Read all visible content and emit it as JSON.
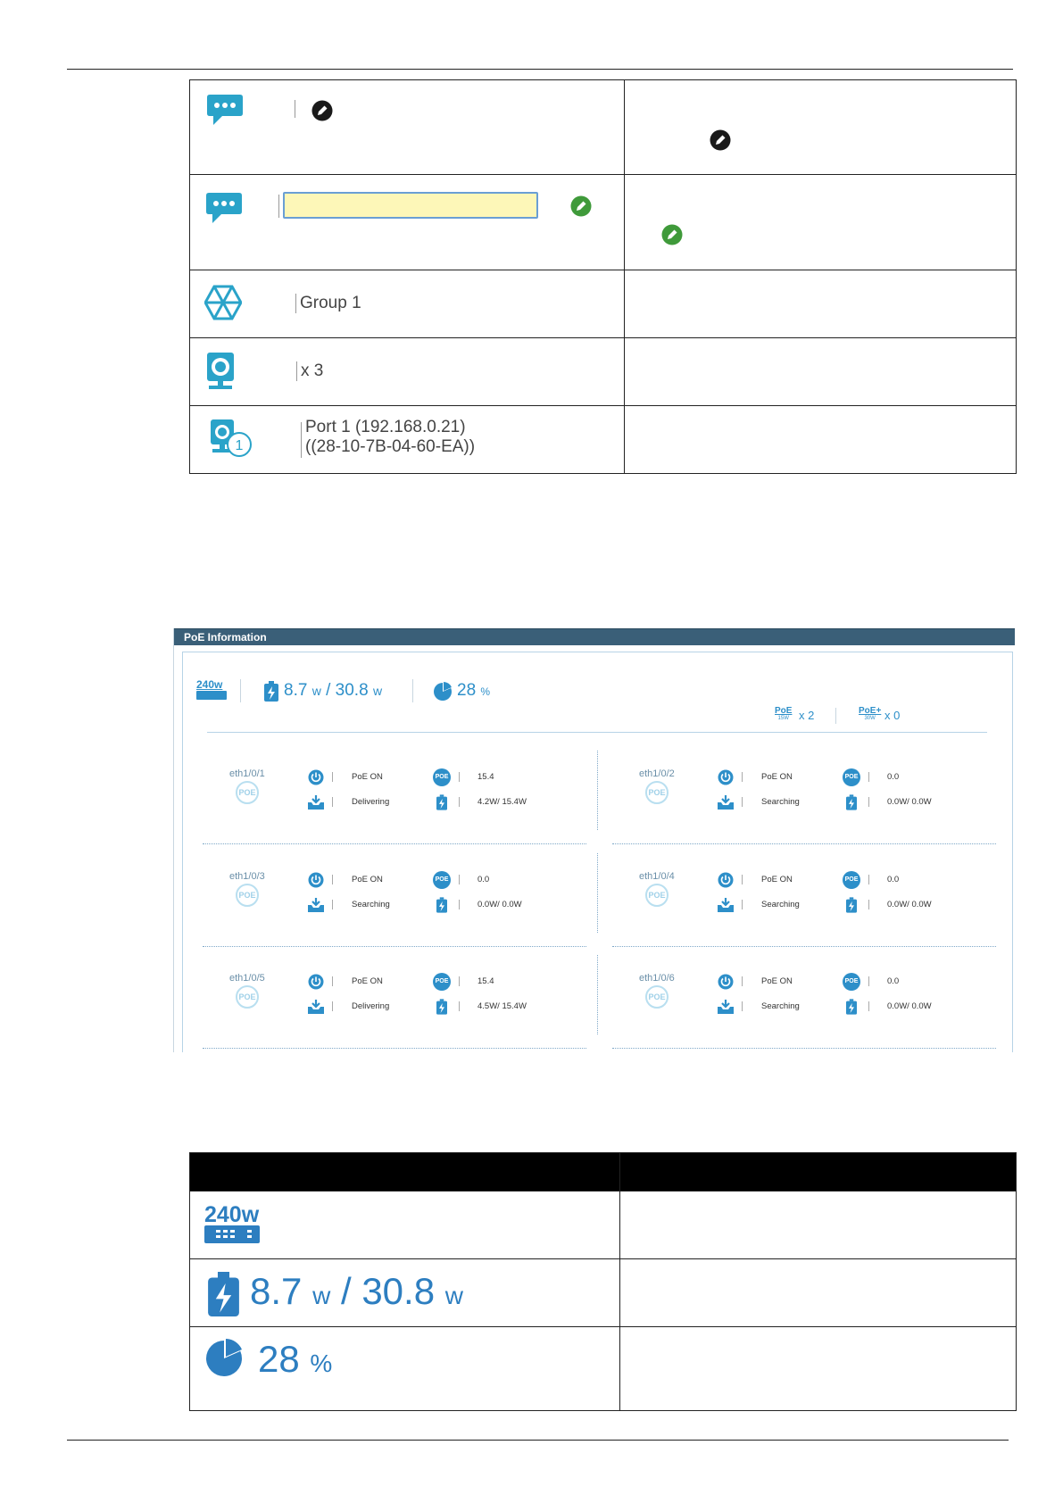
{
  "top_table": {
    "rows": [
      {
        "left_text": "|",
        "right_text": ""
      },
      {
        "left_text": "",
        "right_text": ""
      },
      {
        "left_text": "Group 1",
        "right_text": ""
      },
      {
        "left_text": "x 3",
        "right_text": ""
      },
      {
        "left_text_line1": "Port 1 (192.168.0.21)",
        "left_text_line2": "((28-10-7B-04-60-EA))",
        "right_text": ""
      }
    ]
  },
  "poe_panel": {
    "title": "PoE Information",
    "budget_icon_label": "240w",
    "power_used": "8.7",
    "power_unit": "w",
    "power_separator": "/",
    "power_total": "30.8",
    "power_total_unit": "w",
    "usage_percent": "28",
    "usage_unit": "%",
    "poe_label": "PoE",
    "poe_sub": "15W",
    "poe_count": "x 2",
    "poeplus_label": "PoE+",
    "poeplus_sub": "30W",
    "poeplus_count": "x 0",
    "ports": [
      {
        "name": "eth1/0/1",
        "status": "PoE ON",
        "state": "Delivering",
        "class": "15.4",
        "power": "4.2W/ 15.4W"
      },
      {
        "name": "eth1/0/2",
        "status": "PoE ON",
        "state": "Searching",
        "class": "0.0",
        "power": "0.0W/ 0.0W"
      },
      {
        "name": "eth1/0/3",
        "status": "PoE ON",
        "state": "Searching",
        "class": "0.0",
        "power": "0.0W/ 0.0W"
      },
      {
        "name": "eth1/0/4",
        "status": "PoE ON",
        "state": "Searching",
        "class": "0.0",
        "power": "0.0W/ 0.0W"
      },
      {
        "name": "eth1/0/5",
        "status": "PoE ON",
        "state": "Delivering",
        "class": "15.4",
        "power": "4.5W/ 15.4W"
      },
      {
        "name": "eth1/0/6",
        "status": "PoE ON",
        "state": "Searching",
        "class": "0.0",
        "power": "0.0W/ 0.0W"
      }
    ],
    "poe_badge_text": "POE",
    "colors": {
      "accent": "#2d8fc9",
      "header": "#3a5f78",
      "light": "#9fd0e8"
    }
  },
  "bottom_table": {
    "header_left": "",
    "header_right": "",
    "row1_icon_label": "240w",
    "row2_used": "8.7",
    "row2_unit": "w",
    "row2_sep": "/",
    "row2_total": "30.8",
    "row2_total_unit": "w",
    "row3_percent": "28",
    "row3_unit": "%"
  }
}
